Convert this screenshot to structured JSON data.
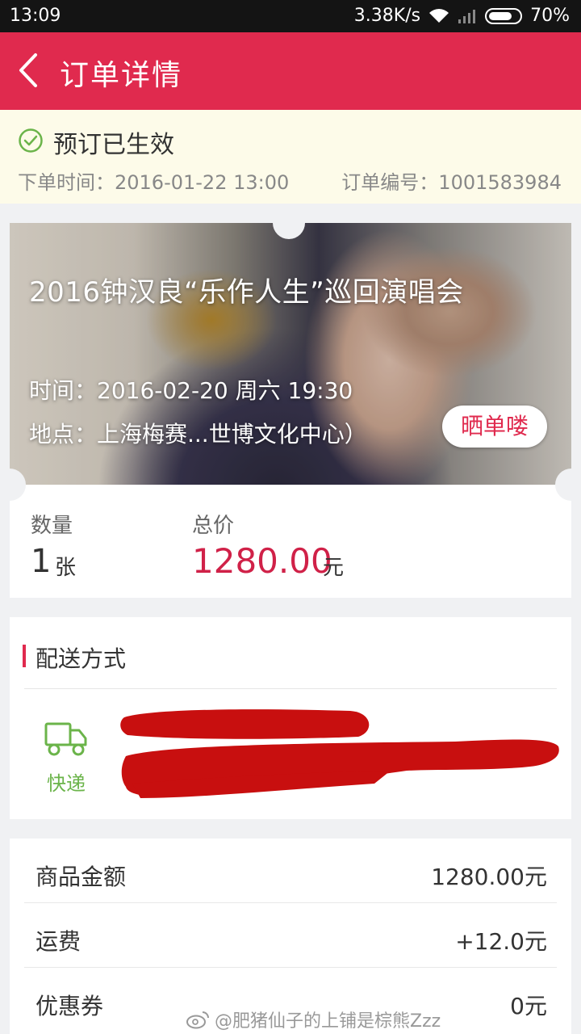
{
  "status_bar": {
    "time": "13:09",
    "speed": "3.38K/s",
    "battery": "70%"
  },
  "header": {
    "title": "订单详情"
  },
  "order_status": {
    "text": "预订已生效",
    "order_time": "下单时间：2016-01-22 13:00",
    "order_number": "订单编号：1001583984"
  },
  "ticket": {
    "title": "2016钟汉良“乐作人生”巡回演唱会",
    "time": "时间：2016-02-20 周六 19:30",
    "venue": "地点：上海梅赛...世博文化中心）",
    "share_label": "晒单喽",
    "quantity_label": "数量",
    "quantity_value": "1",
    "quantity_unit": "张",
    "total_label": "总价",
    "total_value": "1280.00",
    "total_unit": "元"
  },
  "delivery": {
    "heading": "配送方式",
    "method": "快递"
  },
  "fees": [
    {
      "label": "商品金额",
      "value": "1280.00元"
    },
    {
      "label": "运费",
      "value": "+12.0元"
    },
    {
      "label": "优惠券",
      "value": "0元"
    }
  ],
  "watermark": "@肥猪仙子的上铺是棕熊Zzz",
  "colors": {
    "accent": "#e02a4e",
    "success": "#6bb44a",
    "status_bg": "#fdfbe9"
  }
}
